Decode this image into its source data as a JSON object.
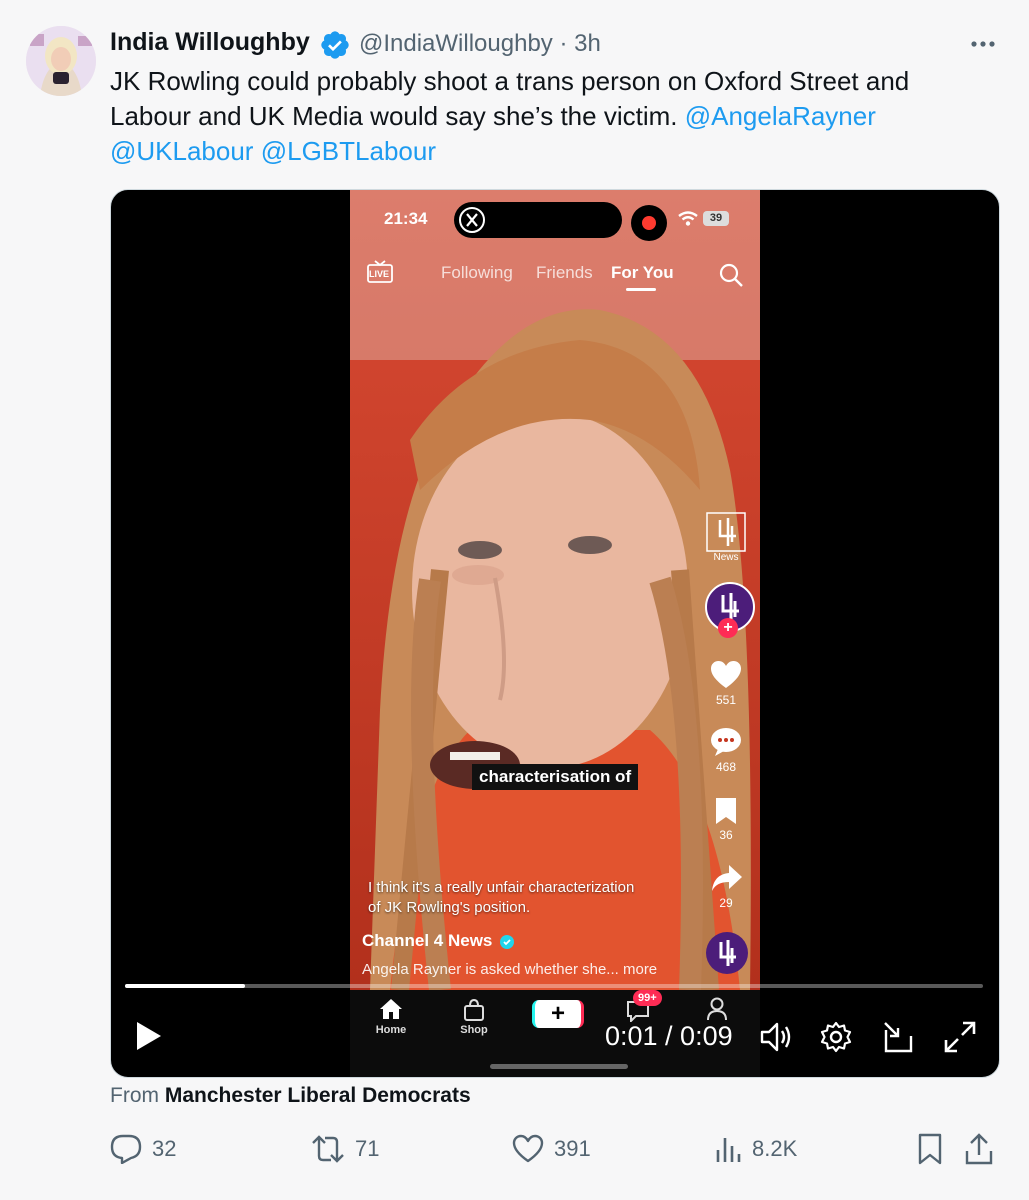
{
  "author": {
    "name": "India Willoughby",
    "handle": "@IndiaWilloughby",
    "separator": "·",
    "time": "3h"
  },
  "tweet": {
    "text": "JK Rowling could probably shoot a trans person on Oxford Street and Labour and UK Media would say she’s the victim.",
    "mentions": [
      "@AngelaRayner",
      "@UKLabour",
      "@LGBTLabour"
    ]
  },
  "video": {
    "phone_time": "21:34",
    "battery": "39",
    "nav": [
      "Following",
      "Friends",
      "For You"
    ],
    "live_label": "LIVE",
    "rail_logo_label": "News",
    "likes": "551",
    "comments": "468",
    "saves": "36",
    "shares": "29",
    "caption": "characterisation of",
    "subtitle_line1": "I think it's a really unfair characterization",
    "subtitle_line2": "of JK Rowling's position.",
    "channel": "Channel 4 News",
    "description": "Angela Rayner is asked whether she... more",
    "tabs": [
      "Home",
      "Shop",
      "",
      "",
      ""
    ],
    "inbox_badge": "99+",
    "timecode": "0:01 / 0:09",
    "progress": 0.14
  },
  "footer": {
    "from_label": "From",
    "from_source": "Manchester Liberal Democrats"
  },
  "actions": {
    "replies": "32",
    "reposts": "71",
    "likes": "391",
    "views": "8.2K"
  },
  "colors": {
    "accent": "#1d9bf0",
    "muted": "#536471"
  }
}
